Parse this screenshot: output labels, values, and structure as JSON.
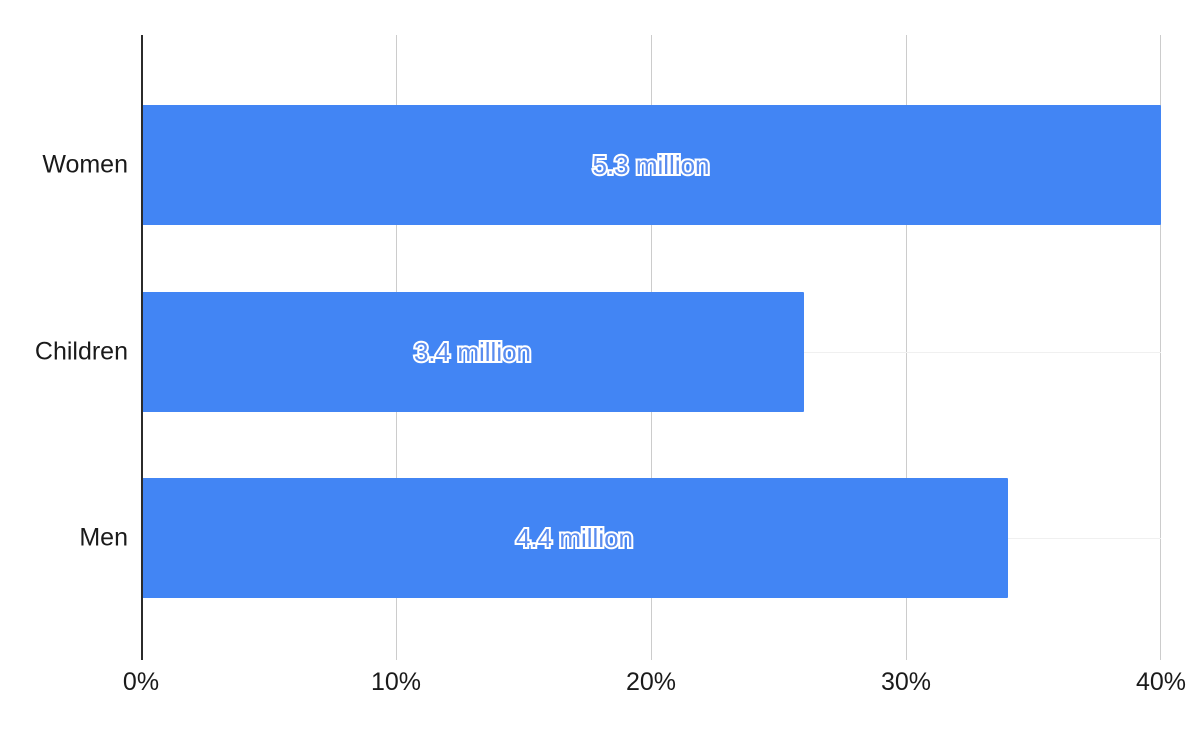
{
  "chart_data": {
    "type": "bar",
    "orientation": "horizontal",
    "title": "",
    "subtitle": "",
    "xlabel": "",
    "ylabel": "",
    "categories": [
      "Women",
      "Children",
      "Men"
    ],
    "values": [
      40,
      26,
      34
    ],
    "value_labels": [
      "5.3 million",
      "3.4 million",
      "4.4 million"
    ],
    "series": [
      {
        "name": "",
        "values": [
          40,
          26,
          34
        ],
        "color": "#4285F4"
      }
    ],
    "xlim": [
      0,
      40
    ],
    "x_tick_values": [
      0,
      10,
      20,
      30,
      40
    ],
    "x_tick_labels": [
      "0%",
      "10%",
      "20%",
      "30%",
      "40%"
    ],
    "grid": {
      "vertical": true,
      "horizontal": true,
      "vertical_color": "#cccccc",
      "horizontal_color": "#f0f0f0"
    },
    "axis_line_color": "#2b2b2b",
    "legend": {
      "visible": false,
      "position": "none"
    },
    "bar_color": "#4285F4",
    "data_label_color": "#ffffff",
    "data_label_outline_color": "#ffffff",
    "background_color": "#ffffff"
  },
  "axis": {
    "x_ticks": [
      {
        "label": "0%",
        "value": 0
      },
      {
        "label": "10%",
        "value": 10
      },
      {
        "label": "20%",
        "value": 20
      },
      {
        "label": "30%",
        "value": 30
      },
      {
        "label": "40%",
        "value": 40
      }
    ],
    "y_ticks": [
      {
        "label": "Women",
        "value": 40
      },
      {
        "label": "Children",
        "value": 26
      },
      {
        "label": "Men",
        "value": 34
      }
    ]
  },
  "bars": [
    {
      "category": "Women",
      "percent": 40,
      "data_label": "5.3 million"
    },
    {
      "category": "Children",
      "percent": 26,
      "data_label": "3.4 million"
    },
    {
      "category": "Men",
      "percent": 34,
      "data_label": "4.4 million"
    }
  ]
}
